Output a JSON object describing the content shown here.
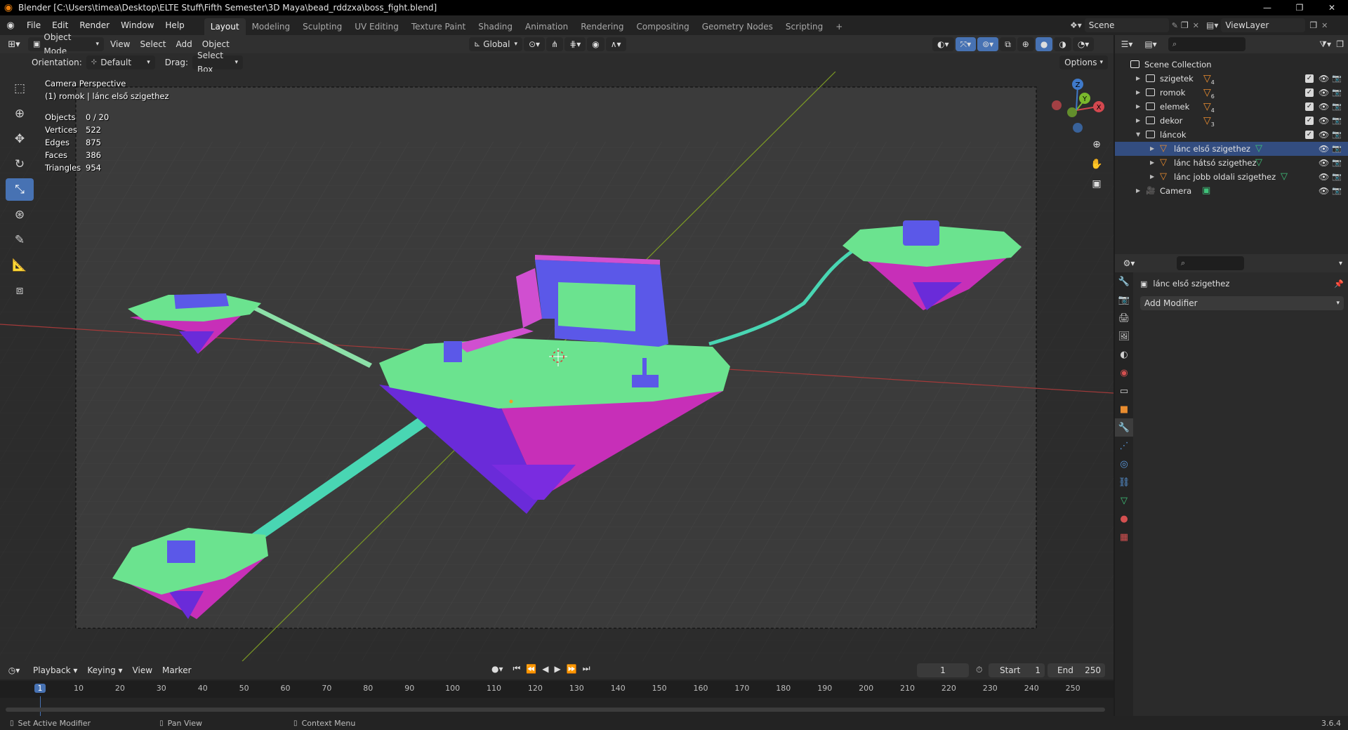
{
  "window": {
    "title": "Blender [C:\\Users\\timea\\Desktop\\ELTE Stuff\\Fifth Semester\\3D Maya\\bead_rddzxa\\boss_fight.blend]",
    "controls": [
      "—",
      "❐",
      "✕"
    ]
  },
  "menubar": {
    "menus": [
      "File",
      "Edit",
      "Render",
      "Window",
      "Help"
    ],
    "workspaces": [
      "Layout",
      "Modeling",
      "Sculpting",
      "UV Editing",
      "Texture Paint",
      "Shading",
      "Animation",
      "Rendering",
      "Compositing",
      "Geometry Nodes",
      "Scripting"
    ],
    "active_workspace": "Layout",
    "add_tab": "+",
    "scene": "Scene",
    "view_layer": "ViewLayer"
  },
  "viewport_header": {
    "mode": "Object Mode",
    "menus": [
      "View",
      "Select",
      "Add",
      "Object"
    ],
    "transform_orientation": "Global"
  },
  "tool_settings": {
    "orientation_label": "Orientation:",
    "orientation_value": "Default",
    "drag_label": "Drag:",
    "drag_value": "Select Box",
    "options": "Options"
  },
  "viewport": {
    "camera_label": "Camera Perspective",
    "context_label": "(1) romok | lánc első szigethez",
    "stats": [
      {
        "label": "Objects",
        "value": "0 / 20"
      },
      {
        "label": "Vertices",
        "value": "522"
      },
      {
        "label": "Edges",
        "value": "875"
      },
      {
        "label": "Faces",
        "value": "386"
      },
      {
        "label": "Triangles",
        "value": "954"
      }
    ],
    "gizmo_axes": [
      "X",
      "Y",
      "Z"
    ],
    "colors": {
      "top": "#6be38f",
      "side_a": "#6a2bd9",
      "side_b": "#c72fb8",
      "accent_blue": "#5b58e8",
      "chain": "#49d6b3"
    }
  },
  "toolbar": {
    "tools": [
      "select-box",
      "cursor",
      "move",
      "rotate",
      "scale",
      "transform",
      "annotate",
      "measure",
      "add-cube"
    ],
    "active": "scale"
  },
  "timeline": {
    "menus": [
      "Playback",
      "Keying",
      "View",
      "Marker"
    ],
    "current_frame": "1",
    "start_label": "Start",
    "start": "1",
    "end_label": "End",
    "end": "250",
    "ticks": [
      "1",
      "10",
      "20",
      "30",
      "40",
      "50",
      "60",
      "70",
      "80",
      "90",
      "100",
      "110",
      "120",
      "130",
      "140",
      "150",
      "160",
      "170",
      "180",
      "190",
      "200",
      "210",
      "220",
      "230",
      "240",
      "250"
    ]
  },
  "outliner": {
    "root": "Scene Collection",
    "items": [
      {
        "name": "szigetek",
        "type": "collection",
        "count": "4",
        "depth": 0,
        "expanded": false
      },
      {
        "name": "romok",
        "type": "collection",
        "count": "6",
        "depth": 0,
        "expanded": false
      },
      {
        "name": "elemek",
        "type": "collection",
        "count": "4",
        "depth": 0,
        "expanded": false
      },
      {
        "name": "dekor",
        "type": "collection",
        "count": "3",
        "depth": 0,
        "expanded": false
      },
      {
        "name": "láncok",
        "type": "collection",
        "count": "",
        "depth": 0,
        "expanded": true
      },
      {
        "name": "lánc első szigethez",
        "type": "object",
        "count": "",
        "depth": 1,
        "expanded": false
      },
      {
        "name": "lánc hátsó szigethez",
        "type": "object",
        "count": "",
        "depth": 1,
        "expanded": false
      },
      {
        "name": "lánc jobb oldali szigethez",
        "type": "object",
        "count": "",
        "depth": 1,
        "expanded": false
      },
      {
        "name": "Camera",
        "type": "camera",
        "count": "",
        "depth": 0,
        "expanded": false
      }
    ]
  },
  "properties": {
    "object_name": "lánc első szigethez",
    "add_modifier": "Add Modifier",
    "tabs": [
      "tool",
      "render",
      "output",
      "view-layer",
      "scene",
      "world",
      "collection",
      "object",
      "modifiers",
      "particles",
      "physics",
      "constraints",
      "data",
      "material",
      "texture"
    ],
    "active_tab": "modifiers"
  },
  "statusbar": {
    "hint1": "Set Active Modifier",
    "hint2": "Pan View",
    "hint3": "Context Menu",
    "version": "3.6.4"
  }
}
